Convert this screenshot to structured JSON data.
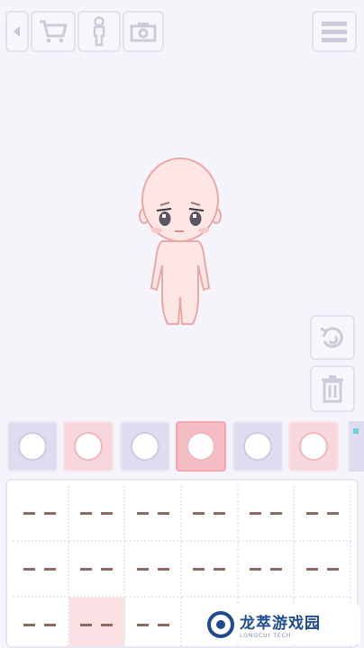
{
  "toolbar": {
    "back_icon": "triangle-left-icon",
    "shop_icon": "cart-icon",
    "body_icon": "figure-icon",
    "camera_icon": "camera-icon",
    "menu_icon": "hamburger-menu-icon"
  },
  "side_actions": {
    "rotate_icon": "rotate-icon",
    "trash_icon": "trash-icon"
  },
  "categories": [
    {
      "icon": "plain-head-icon",
      "selected": false
    },
    {
      "icon": "head-bangs-icon",
      "selected": false
    },
    {
      "icon": "head-side-icon",
      "selected": false
    },
    {
      "icon": "head-face-icon",
      "selected": true
    },
    {
      "icon": "head-ear-icon",
      "selected": false
    },
    {
      "icon": "head-hair-icon",
      "selected": false
    }
  ],
  "items_selected_index": 13,
  "watermark": {
    "brand_cn": "龙萃游戏园",
    "brand_en": "LONGCUI TECH"
  },
  "colors": {
    "accent_pink": "#f6bcc3",
    "lavender": "#dddcf0",
    "skin": "#fde6e4",
    "outline": "#e8a9a6"
  }
}
